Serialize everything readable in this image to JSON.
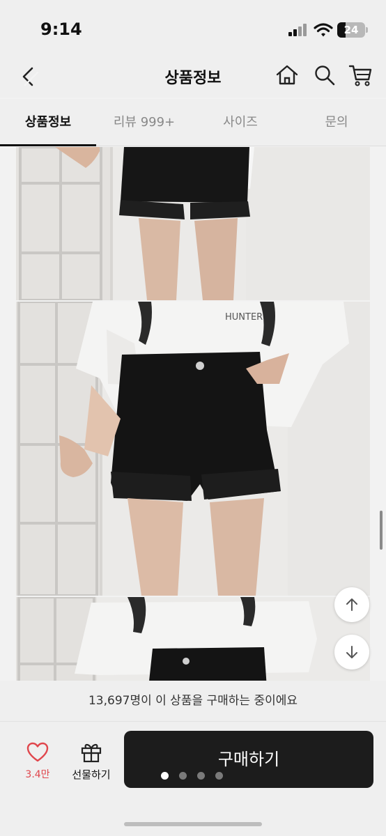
{
  "status_bar": {
    "time": "9:14",
    "battery_level": "24"
  },
  "header": {
    "title": "상품정보"
  },
  "tabs": [
    {
      "label": "상품정보",
      "active": true
    },
    {
      "label": "리뷰 999+",
      "active": false
    },
    {
      "label": "사이즈",
      "active": false
    },
    {
      "label": "문의",
      "active": false
    }
  ],
  "product_images": [
    "product-photo-1",
    "product-photo-2",
    "product-photo-3"
  ],
  "footer": {
    "buyers_notice": "13,697명이 이 상품을 구매하는 중이에요",
    "like_count": "3.4만",
    "gift_label": "선물하기",
    "buy_label": "구매하기",
    "page_dots": {
      "total": 4,
      "active_index": 0
    }
  },
  "colors": {
    "accent": "#1c1c1c",
    "like": "#e0464c",
    "background": "#efefef"
  },
  "icons": [
    "back-chevron-icon",
    "home-icon",
    "search-icon",
    "cart-icon",
    "arrow-up-icon",
    "arrow-down-icon",
    "heart-icon",
    "gift-icon"
  ]
}
